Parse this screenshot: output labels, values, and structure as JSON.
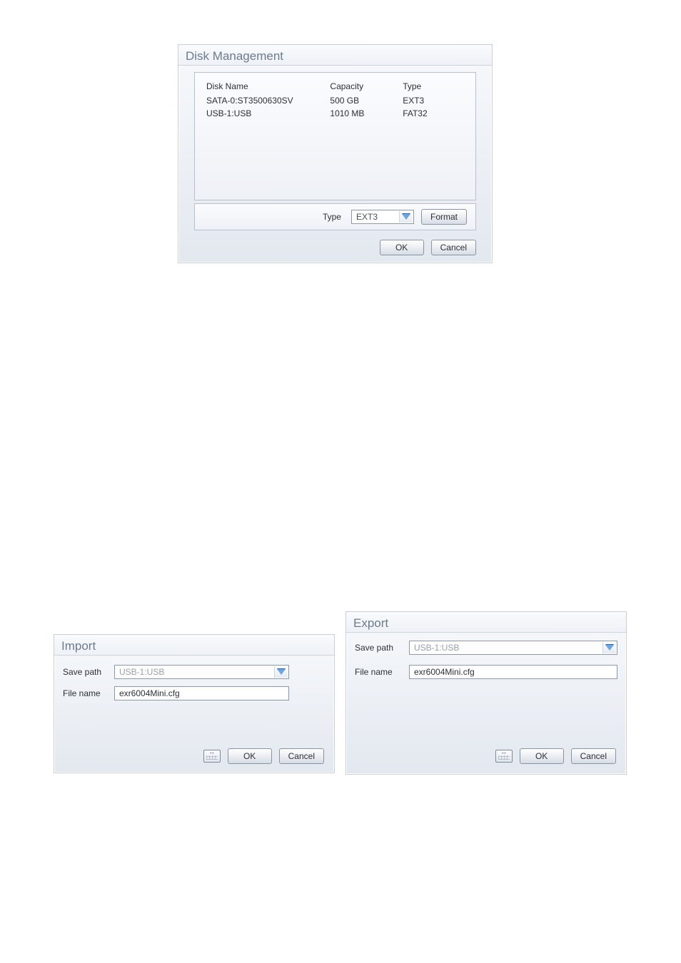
{
  "disk_mgmt": {
    "title": "Disk Management",
    "headers": {
      "name": "Disk Name",
      "capacity": "Capacity",
      "type": "Type"
    },
    "rows": [
      {
        "name": "SATA-0:ST3500630SV",
        "capacity": "500 GB",
        "type": "EXT3"
      },
      {
        "name": "USB-1:USB",
        "capacity": "1010 MB",
        "type": "FAT32"
      }
    ],
    "type_label": "Type",
    "type_value": "EXT3",
    "format_btn": "Format",
    "ok_btn": "OK",
    "cancel_btn": "Cancel"
  },
  "import_dlg": {
    "title": "Import",
    "save_path_label": "Save path",
    "save_path_value": "USB-1:USB",
    "file_name_label": "File name",
    "file_name_value": "exr6004Mini.cfg",
    "ok_btn": "OK",
    "cancel_btn": "Cancel"
  },
  "export_dlg": {
    "title": "Export",
    "save_path_label": "Save path",
    "save_path_value": "USB-1:USB",
    "file_name_label": "File name",
    "file_name_value": "exr6004Mini.cfg",
    "ok_btn": "OK",
    "cancel_btn": "Cancel"
  }
}
